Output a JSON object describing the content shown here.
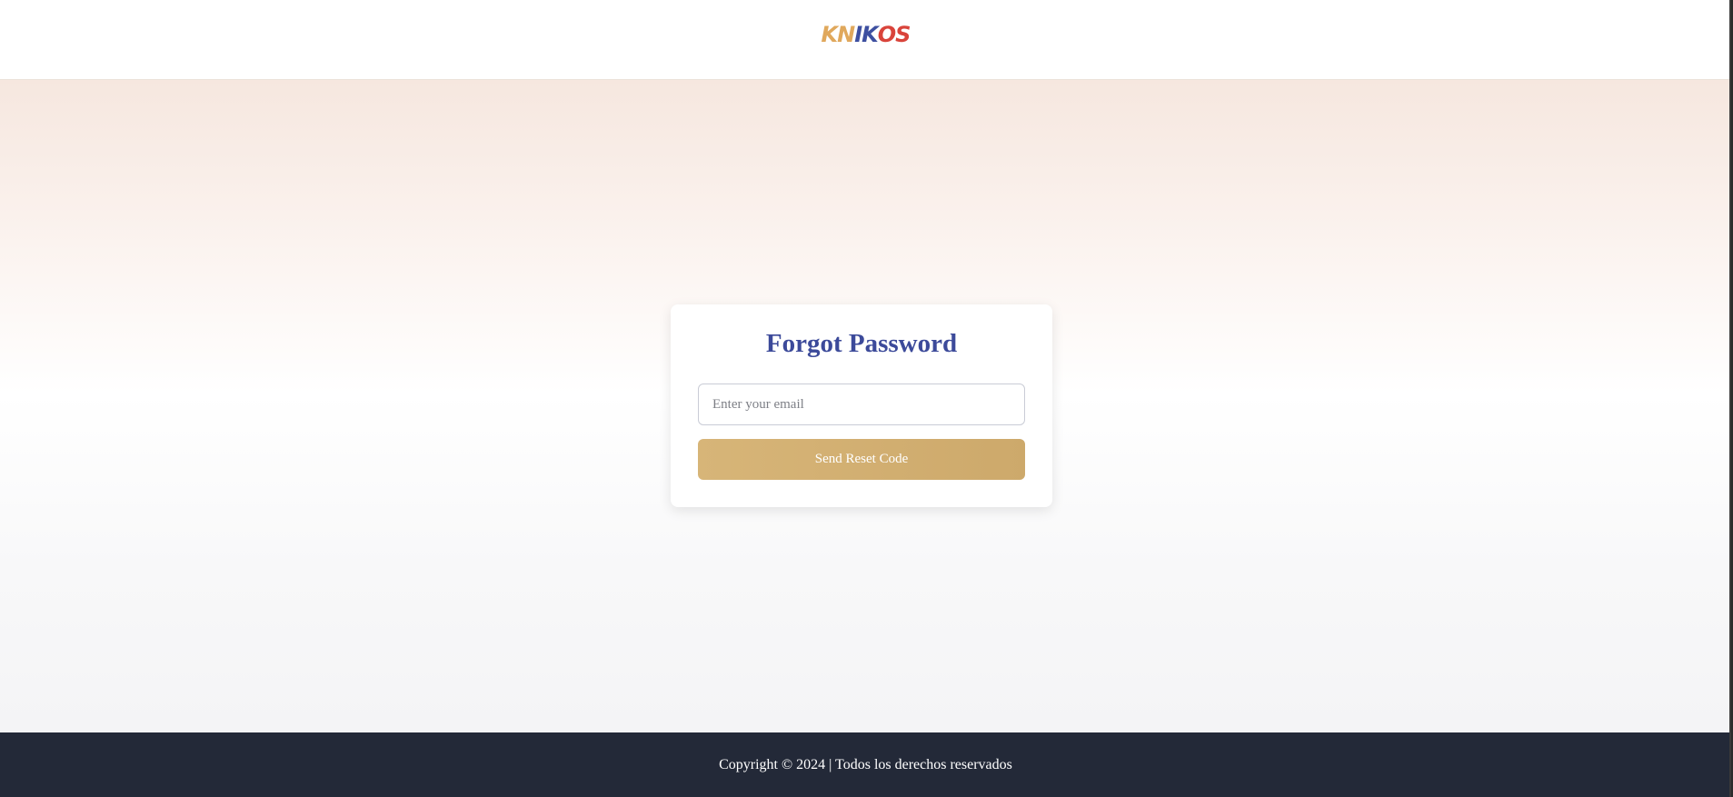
{
  "header": {
    "logo_letters": [
      "K",
      "N",
      "I",
      "K",
      "O",
      "S"
    ]
  },
  "card": {
    "title": "Forgot Password",
    "email_placeholder": "Enter your email",
    "email_value": "",
    "submit_label": "Send Reset Code"
  },
  "footer": {
    "copyright": "Copyright © 2024 | Todos los derechos reservados"
  },
  "colors": {
    "primary_text": "#3c4a9a",
    "button_gold": "#d7b578",
    "footer_bg": "#232938",
    "logo_orange": "#e0a85c",
    "logo_blue": "#3d4fa0",
    "logo_red": "#d9443b"
  }
}
